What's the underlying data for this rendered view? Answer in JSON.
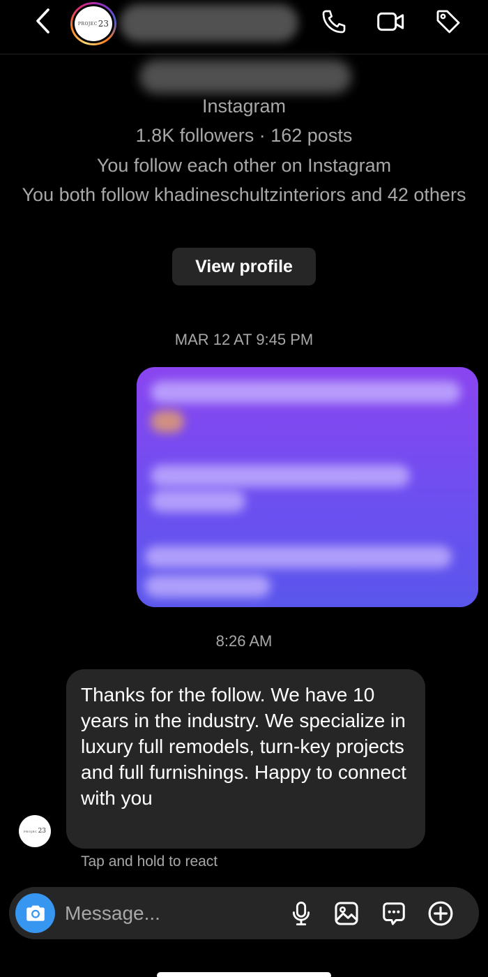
{
  "header": {
    "avatar_logo_text": "PROJEC",
    "avatar_logo_number": "23",
    "back_icon": "chevron-left",
    "call_icon": "phone",
    "video_icon": "video-camera",
    "tag_icon": "tag"
  },
  "profile": {
    "platform": "Instagram",
    "stats": "1.8K followers · 162 posts",
    "mutual_follow": "You follow each other on Instagram",
    "both_follow": "You both follow khadineschultzinteriors and 42 others",
    "view_profile_label": "View profile"
  },
  "thread": {
    "timestamp_1": "MAR 12 AT 9:45 PM",
    "timestamp_2": "8:26 AM",
    "incoming_message": "Thanks  for the follow. We have  10 years in the industry. We specialize in luxury  full remodels, turn-key projects  and full furnishings. Happy to connect with you",
    "react_hint": "Tap and hold to react",
    "sender_logo_text": "PROJEC",
    "sender_logo_number": "23"
  },
  "composer": {
    "placeholder": "Message...",
    "camera_icon": "camera",
    "mic_icon": "microphone",
    "gallery_icon": "image",
    "sticker_icon": "chat-bubble-dots",
    "plus_icon": "plus-circle"
  },
  "colors": {
    "background": "#000000",
    "bubble_incoming": "#262626",
    "bubble_outgoing_top": "#8a45f0",
    "bubble_outgoing_bottom": "#5a56ec",
    "camera_button": "#3797f0",
    "secondary_text": "#a8a8a8"
  }
}
